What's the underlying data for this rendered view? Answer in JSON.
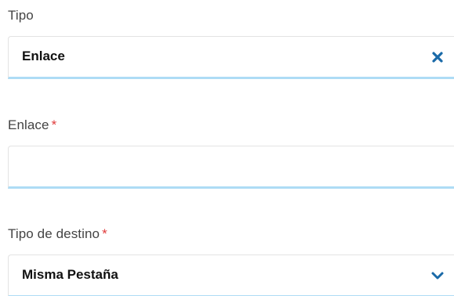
{
  "tipo": {
    "label": "Tipo",
    "value": "Enlace",
    "clear_icon": "close-icon",
    "accent_color": "#1a6aa8"
  },
  "enlace": {
    "label": "Enlace",
    "required_mark": "*",
    "value": ""
  },
  "tipo_destino": {
    "label": "Tipo de destino",
    "required_mark": "*",
    "value": "Misma Pestaña",
    "dropdown_icon": "chevron-down-icon",
    "accent_color": "#1a6aa8"
  },
  "colors": {
    "required": "#e03b3b",
    "field_underline": "#aedcf5",
    "label": "#444444"
  }
}
